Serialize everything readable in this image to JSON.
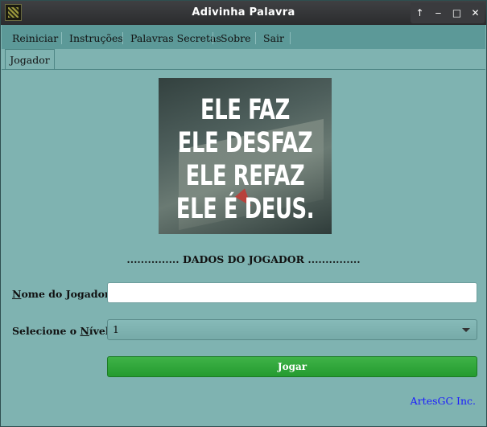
{
  "window": {
    "title": "Adivinha Palavra",
    "controls": {
      "up": "↑",
      "minimize": "‒",
      "maximize": "□",
      "close": "✕"
    }
  },
  "menu": {
    "items": [
      "Reiniciar",
      "Instruções",
      "Palavras Secretas",
      "Sobre",
      "Sair"
    ]
  },
  "tabs": [
    {
      "label": "Jogador",
      "active": true
    }
  ],
  "hero_image": {
    "lines": [
      "ELE FAZ",
      "ELE DESFAZ",
      "ELE REFAZ",
      "ELE É DEUS."
    ]
  },
  "form": {
    "section_title": "............... DADOS DO JOGADOR ...............",
    "name_label_mnemonic": "N",
    "name_label_rest": "ome do Jogador: *",
    "name_value": "",
    "level_label_prefix": "Selecione o ",
    "level_label_mnemonic": "N",
    "level_label_rest": "ível: *",
    "level_selected": "1",
    "play_button": "Jogar"
  },
  "footer": {
    "credit": "ArtesGC Inc."
  },
  "colors": {
    "window_bg": "#7fb3b1",
    "menubar_bg": "#5c9998",
    "play_button": "#2ea83a",
    "credit_link": "#1a1aff"
  }
}
